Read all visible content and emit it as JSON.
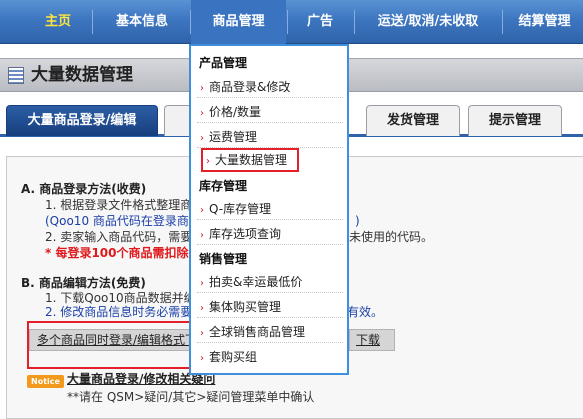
{
  "nav": {
    "items": [
      "主页",
      "基本信息",
      "商品管理",
      "广告",
      "运送/取消/未收取",
      "结算管理"
    ]
  },
  "page": {
    "title": "大量数据管理"
  },
  "tabs": [
    "大量商品登录/编辑",
    "发货管理",
    "提示管理"
  ],
  "content": {
    "sectionA": {
      "heading": "A. 商品登录方法(收费)",
      "line1": "1. 根据登录文件格式整理商",
      "line2": "(Qoo10 商品代码在登录商",
      "line2_tail": ")",
      "line3": "2. 卖家输入商品代码，需要",
      "line3_tail": "未使用的代码。",
      "warning": "* 每登录100个商品需扣除"
    },
    "sectionB": {
      "heading": "B. 商品编辑方法(免费)",
      "line1": "1. 下载Qoo10商品数据并编",
      "line2": "2. 修改商品信息时务必需要",
      "line2_tail": "有效。"
    },
    "format_button": "多个商品同时登录/编辑格式下",
    "download_button_partial": "下载",
    "notice": {
      "badge": "Notice",
      "title": "大量商品登录/修改相关疑问",
      "text": "**请在 QSM>疑问/其它>疑问管理菜单中确认"
    }
  },
  "dropdown": {
    "groups": [
      {
        "title": "产品管理",
        "items": [
          "商品登录&修改",
          "价格/数量",
          "运费管理",
          "大量数据管理"
        ]
      },
      {
        "title": "库存管理",
        "items": [
          "Q-库存管理",
          "库存选项查询"
        ]
      },
      {
        "title": "销售管理",
        "items": [
          "拍卖&幸运最低价",
          "集体购买管理",
          "全球销售商品管理",
          "套购买组"
        ]
      }
    ],
    "selected_item": "大量数据管理"
  },
  "colors": {
    "nav_bg": "#3d76c0",
    "nav_active_text": "#ffe33c",
    "tab_active_bg": "#1f4d91",
    "highlight_red": "#e32028",
    "dropdown_border": "#3e8fdc",
    "chevron_red": "#c9181e",
    "notice_orange": "#f39a1d"
  }
}
